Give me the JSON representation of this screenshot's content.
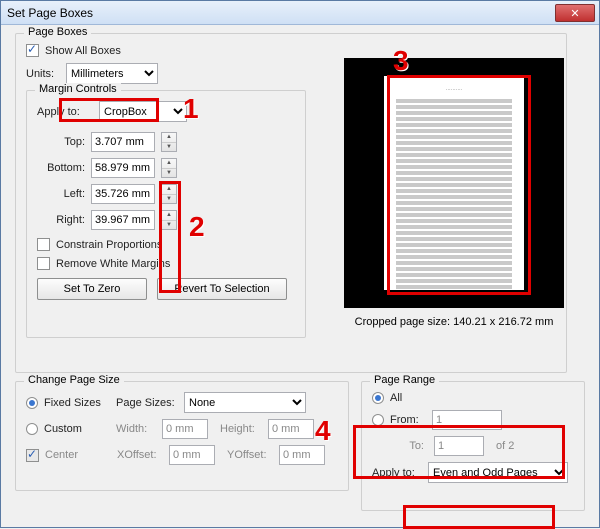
{
  "window": {
    "title": "Set Page Boxes",
    "close": "✕"
  },
  "page_boxes_group": {
    "legend": "Page Boxes",
    "show_all": "Show All Boxes",
    "units_label": "Units:",
    "units_value": "Millimeters",
    "margin_controls": {
      "legend": "Margin Controls",
      "apply_to_label": "Apply to:",
      "apply_to_value": "CropBox",
      "top_label": "Top:",
      "top_value": "3.707 mm",
      "bottom_label": "Bottom:",
      "bottom_value": "58.979 mm",
      "left_label": "Left:",
      "left_value": "35.726 mm",
      "right_label": "Right:",
      "right_value": "39.967 mm",
      "constrain": "Constrain Proportions",
      "remove_white": "Remove White Margins",
      "set_zero": "Set To Zero",
      "revert": "Revert To Selection"
    }
  },
  "cropped_size": "Cropped page size: 140.21 x 216.72 mm",
  "change_page_size": {
    "legend": "Change Page Size",
    "fixed_sizes": "Fixed Sizes",
    "page_sizes_label": "Page Sizes:",
    "page_sizes_value": "None",
    "custom": "Custom",
    "width_label": "Width:",
    "width_value": "0 mm",
    "height_label": "Height:",
    "height_value": "0 mm",
    "center": "Center",
    "xoffset_label": "XOffset:",
    "xoffset_value": "0 mm",
    "yoffset_label": "YOffset:",
    "yoffset_value": "0 mm"
  },
  "page_range": {
    "legend": "Page Range",
    "all": "All",
    "from_label": "From:",
    "from_value": "1",
    "to_label": "To:",
    "to_value": "1",
    "of_label": "of 2",
    "apply_to_label": "Apply to:",
    "apply_to_value": "Even and Odd Pages"
  },
  "callouts": {
    "c1": "1",
    "c2": "2",
    "c3": "3",
    "c4": "4"
  }
}
